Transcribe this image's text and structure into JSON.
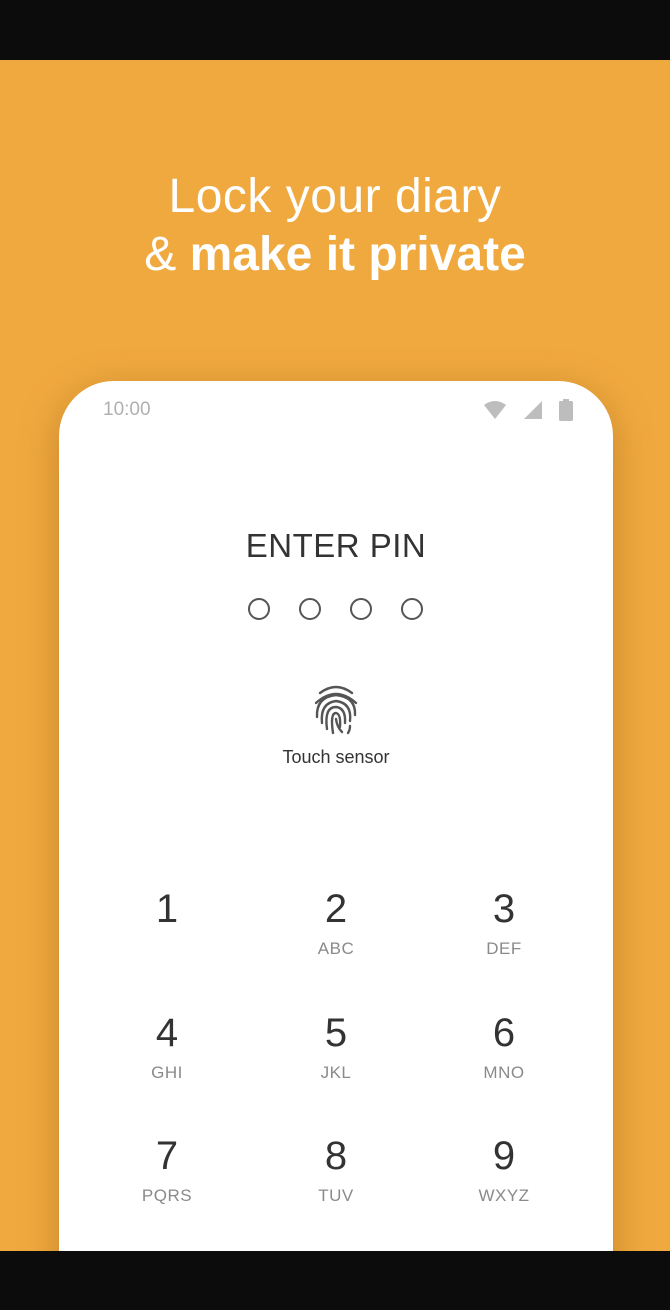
{
  "headline": {
    "line1": "Lock your diary",
    "line2_prefix": "& ",
    "line2_bold": "make it private"
  },
  "phone": {
    "status": {
      "time": "10:00",
      "icons": [
        "wifi-icon",
        "cell-signal-icon",
        "battery-icon"
      ]
    },
    "pin_title": "ENTER PIN",
    "pin_length": 4,
    "fingerprint": {
      "icon": "fingerprint-icon",
      "label": "Touch sensor"
    },
    "keypad": [
      {
        "num": "1",
        "letters": ""
      },
      {
        "num": "2",
        "letters": "ABC"
      },
      {
        "num": "3",
        "letters": "DEF"
      },
      {
        "num": "4",
        "letters": "GHI"
      },
      {
        "num": "5",
        "letters": "JKL"
      },
      {
        "num": "6",
        "letters": "MNO"
      },
      {
        "num": "7",
        "letters": "PQRS"
      },
      {
        "num": "8",
        "letters": "TUV"
      },
      {
        "num": "9",
        "letters": "WXYZ"
      }
    ]
  },
  "colors": {
    "background": "#f0a93f",
    "phone": "#ffffff",
    "text_dark": "#333333",
    "text_muted": "#8a8a8a"
  }
}
